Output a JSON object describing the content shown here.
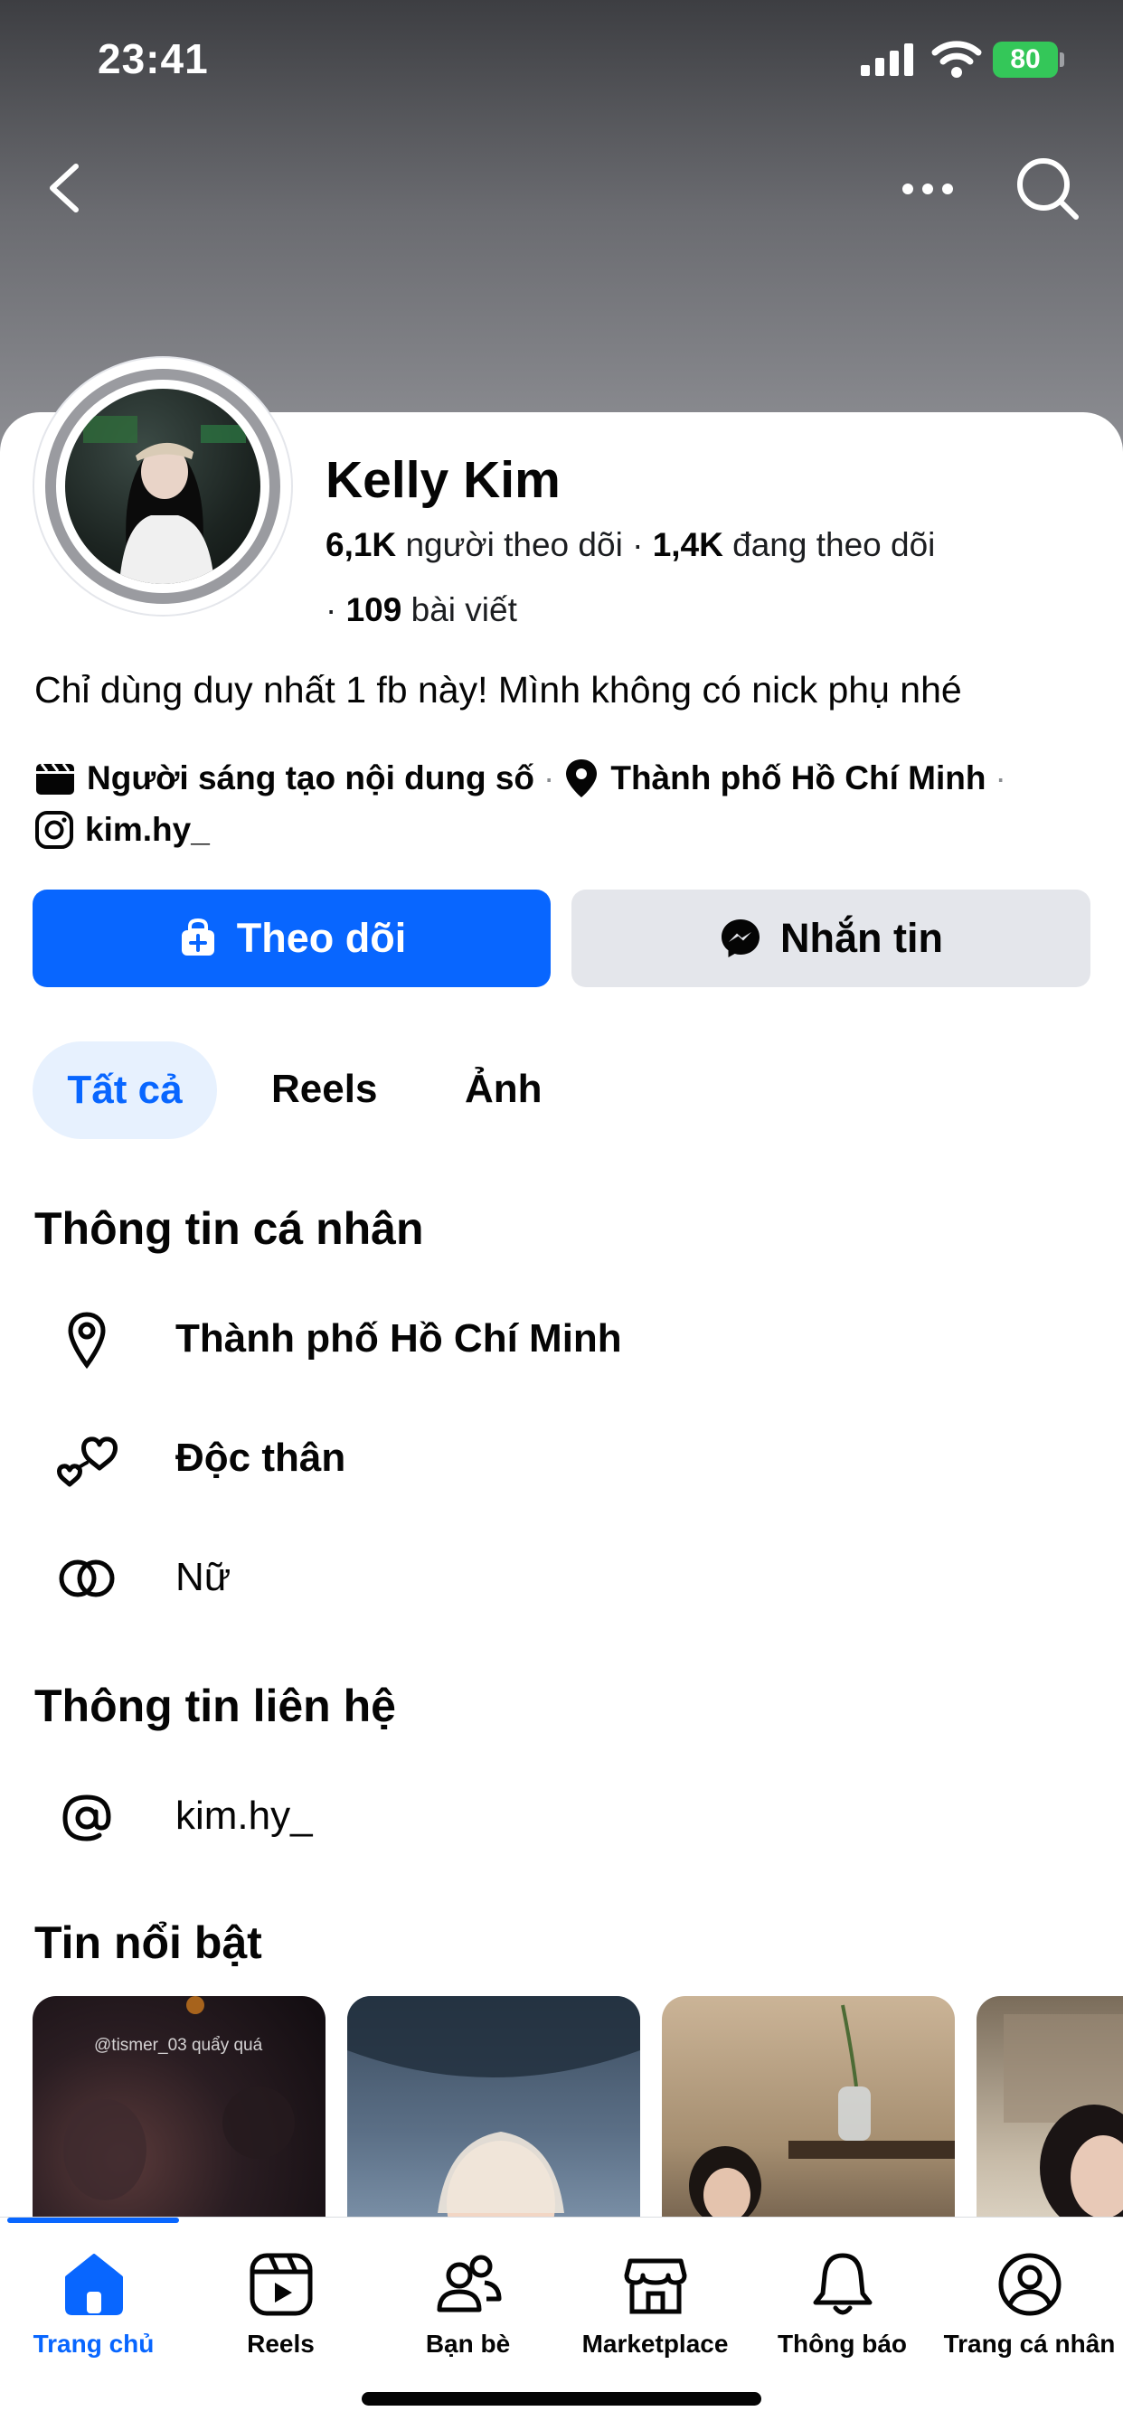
{
  "status_bar": {
    "time": "23:41",
    "battery": "80"
  },
  "header_icons": {
    "back": "chevron-left-icon",
    "more": "more-dots-icon",
    "search": "search-icon"
  },
  "profile": {
    "name": "Kelly Kim",
    "followers_count": "6,1K",
    "followers_label": "người theo dõi",
    "following_count": "1,4K",
    "following_label": "đang theo dõi",
    "posts_count": "109",
    "posts_label": "bài viết",
    "bio": "Chỉ dùng duy nhất 1 fb này! Mình không có nick phụ nhé",
    "category": "Người sáng tạo nội dung số",
    "location": "Thành phố Hồ Chí Minh",
    "instagram": "kim.hy_"
  },
  "actions": {
    "follow": "Theo dõi",
    "message": "Nhắn tin"
  },
  "tabs": [
    {
      "label": "Tất cả",
      "active": true
    },
    {
      "label": "Reels",
      "active": false
    },
    {
      "label": "Ảnh",
      "active": false
    }
  ],
  "personal_info": {
    "title": "Thông tin cá nhân",
    "items": [
      {
        "icon": "location-pin-icon",
        "text": "Thành phố Hồ Chí Minh"
      },
      {
        "icon": "hearts-icon",
        "text": "Độc thân"
      },
      {
        "icon": "gender-rings-icon",
        "text": "Nữ"
      }
    ]
  },
  "contact_info": {
    "title": "Thông tin liên hệ",
    "items": [
      {
        "icon": "at-sign-icon",
        "text": "kim.hy_"
      }
    ]
  },
  "highlights": {
    "title": "Tin nổi bật",
    "caption_first": "@tismer_03 quẩy quá"
  },
  "bottom_nav": [
    {
      "label": "Trang chủ",
      "icon": "home-icon",
      "active": true
    },
    {
      "label": "Reels",
      "icon": "reels-icon",
      "active": false
    },
    {
      "label": "Bạn bè",
      "icon": "friends-icon",
      "active": false
    },
    {
      "label": "Marketplace",
      "icon": "marketplace-icon",
      "active": false
    },
    {
      "label": "Thông báo",
      "icon": "bell-icon",
      "active": false
    },
    {
      "label": "Trang cá nhân",
      "icon": "profile-icon",
      "active": false
    }
  ],
  "colors": {
    "accent": "#0866ff",
    "tab_bg": "#e7f1fe",
    "secondary_button": "#e4e6eb",
    "battery": "#34c759"
  }
}
